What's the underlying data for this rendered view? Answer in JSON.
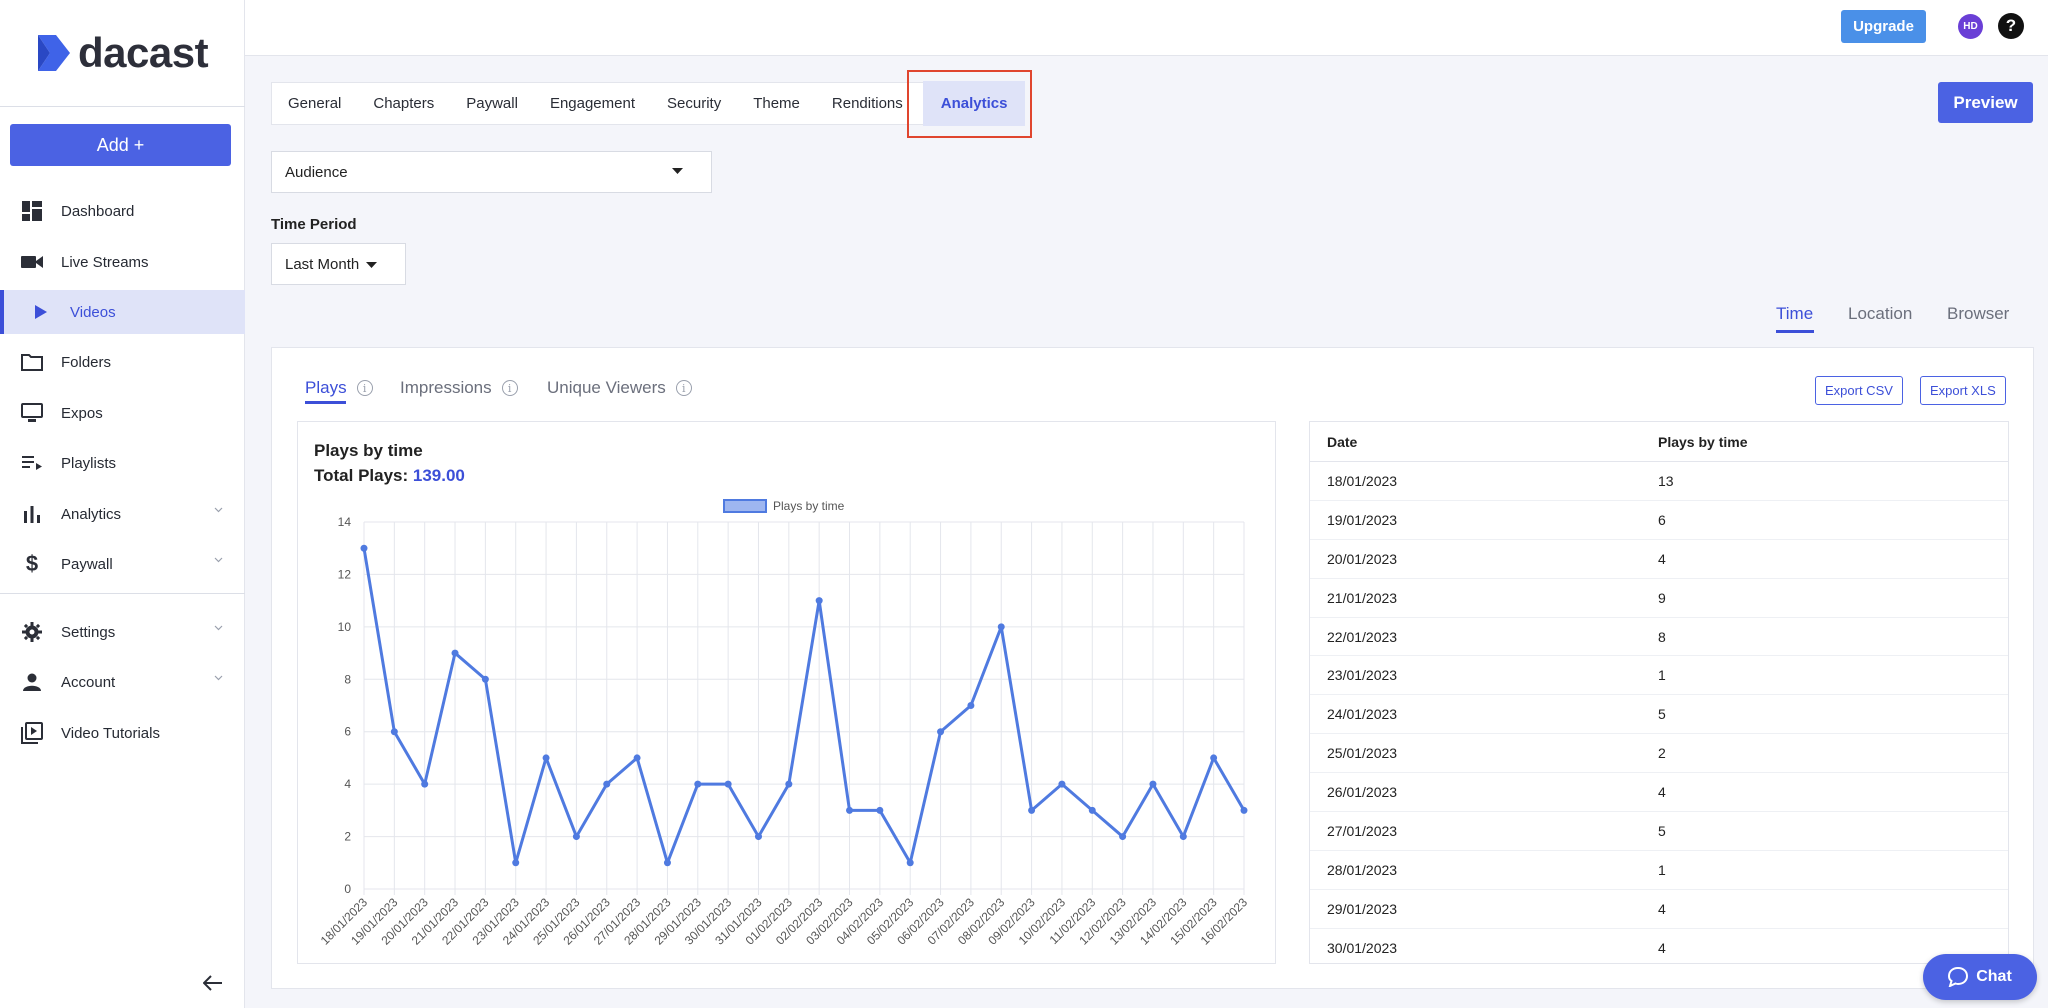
{
  "brand": {
    "name": "dacast",
    "accent": "#4b62e3"
  },
  "sidebar": {
    "add_label": "Add +",
    "items": [
      {
        "label": "Dashboard",
        "icon": "dashboard-icon"
      },
      {
        "label": "Live Streams",
        "icon": "camera-icon"
      },
      {
        "label": "Videos",
        "icon": "play-icon",
        "active": true
      },
      {
        "label": "Folders",
        "icon": "folder-icon"
      },
      {
        "label": "Expos",
        "icon": "monitor-icon"
      },
      {
        "label": "Playlists",
        "icon": "playlist-icon"
      },
      {
        "label": "Analytics",
        "icon": "bar-chart-icon",
        "expandable": true
      },
      {
        "label": "Paywall",
        "icon": "dollar-icon",
        "expandable": true
      },
      {
        "label": "Settings",
        "icon": "gear-icon",
        "expandable": true
      },
      {
        "label": "Account",
        "icon": "user-icon",
        "expandable": true
      },
      {
        "label": "Video Tutorials",
        "icon": "video-library-icon"
      }
    ]
  },
  "topbar": {
    "upgrade_label": "Upgrade",
    "avatar_initials": "HD",
    "help_label": "?"
  },
  "tabs": [
    "General",
    "Chapters",
    "Paywall",
    "Engagement",
    "Security",
    "Theme",
    "Renditions",
    "Analytics"
  ],
  "active_tab": "Analytics",
  "preview_label": "Preview",
  "report_select": {
    "value": "Audience"
  },
  "time_period": {
    "label": "Time Period",
    "value": "Last Month"
  },
  "view_tabs": [
    "Time",
    "Location",
    "Browser"
  ],
  "metric_tabs": [
    "Plays",
    "Impressions",
    "Unique Viewers"
  ],
  "export": {
    "csv": "Export CSV",
    "xls": "Export XLS"
  },
  "chart": {
    "title": "Plays by time",
    "total_label": "Total Plays:",
    "total_value": "139.00"
  },
  "table": {
    "headers": [
      "Date",
      "Plays by time"
    ],
    "rows": [
      [
        "18/01/2023",
        "13"
      ],
      [
        "19/01/2023",
        "6"
      ],
      [
        "20/01/2023",
        "4"
      ],
      [
        "21/01/2023",
        "9"
      ],
      [
        "22/01/2023",
        "8"
      ],
      [
        "23/01/2023",
        "1"
      ],
      [
        "24/01/2023",
        "5"
      ],
      [
        "25/01/2023",
        "2"
      ],
      [
        "26/01/2023",
        "4"
      ],
      [
        "27/01/2023",
        "5"
      ],
      [
        "28/01/2023",
        "1"
      ],
      [
        "29/01/2023",
        "4"
      ],
      [
        "30/01/2023",
        "4"
      ]
    ]
  },
  "chat_label": "Chat",
  "chart_data": {
    "type": "line",
    "categories": [
      "18/01/2023",
      "19/01/2023",
      "20/01/2023",
      "21/01/2023",
      "22/01/2023",
      "23/01/2023",
      "24/01/2023",
      "25/01/2023",
      "26/01/2023",
      "27/01/2023",
      "28/01/2023",
      "29/01/2023",
      "30/01/2023",
      "31/01/2023",
      "01/02/2023",
      "02/02/2023",
      "03/02/2023",
      "04/02/2023",
      "05/02/2023",
      "06/02/2023",
      "07/02/2023",
      "08/02/2023",
      "09/02/2023",
      "10/02/2023",
      "11/02/2023",
      "12/02/2023",
      "13/02/2023",
      "14/02/2023",
      "15/02/2023",
      "16/02/2023"
    ],
    "series": [
      {
        "name": "Plays by time",
        "values": [
          13,
          6,
          4,
          9,
          8,
          1,
          5,
          2,
          4,
          5,
          1,
          4,
          4,
          2,
          4,
          11,
          3,
          3,
          1,
          6,
          7,
          10,
          3,
          4,
          3,
          2,
          4,
          2,
          5,
          3
        ],
        "color": "#4f7ae0"
      }
    ],
    "ylim": [
      0,
      14
    ],
    "yticks": [
      0,
      2,
      4,
      6,
      8,
      10,
      12,
      14
    ],
    "legend": "top",
    "grid": true
  }
}
